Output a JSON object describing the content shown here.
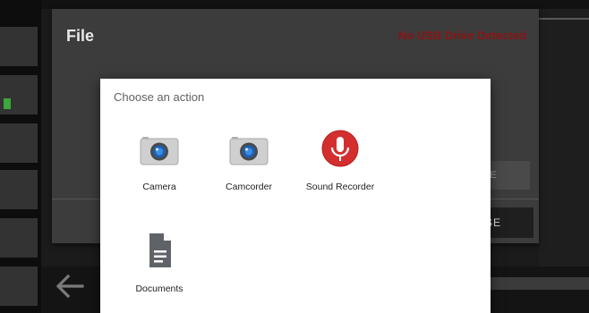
{
  "file_dialog": {
    "title": "File",
    "usb_status": "No USB Drive Detected",
    "delete_label": "LETE",
    "close_label": "LOSE"
  },
  "chooser": {
    "title": "Choose an action",
    "apps": [
      {
        "label": "Camera",
        "icon": "camera-icon"
      },
      {
        "label": "Camcorder",
        "icon": "camcorder-icon"
      },
      {
        "label": "Sound Recorder",
        "icon": "microphone-icon"
      },
      {
        "label": "Documents",
        "icon": "document-icon"
      }
    ]
  },
  "colors": {
    "usb_status": "#8b1414",
    "mic_red": "#d32f2f",
    "dialog_bg": "#ffffff",
    "file_dialog_bg": "#3c3c3c"
  }
}
